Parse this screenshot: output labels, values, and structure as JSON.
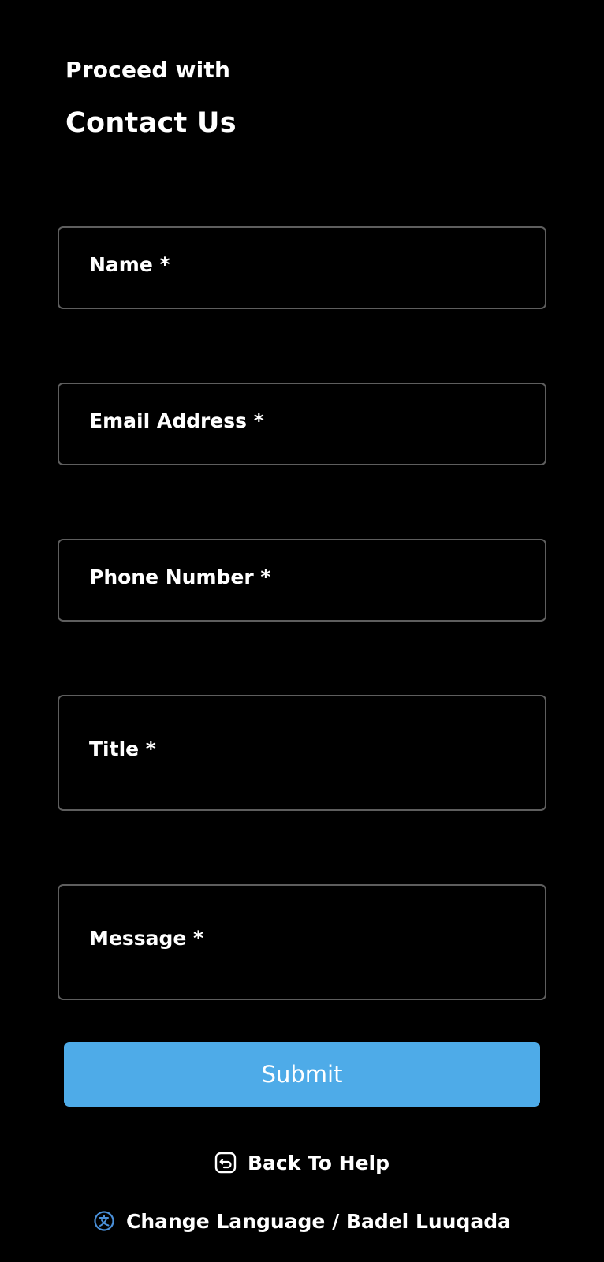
{
  "header": {
    "subtitle": "Proceed with",
    "title": "Contact Us"
  },
  "form": {
    "name_label": "Name *",
    "email_label": "Email Address *",
    "phone_label": "Phone Number *",
    "title_label": "Title *",
    "message_label": "Message *",
    "submit_label": "Submit"
  },
  "links": {
    "back_label": "Back To Help",
    "language_label": "Change Language / Badel Luuqada"
  },
  "colors": {
    "background": "#000000",
    "field_border": "#5e5e5e",
    "accent": "#4eabe8",
    "text": "#ffffff",
    "language_icon": "#4a90d9"
  },
  "icons": {
    "back": "return-arrow-icon",
    "language": "translate-icon"
  }
}
